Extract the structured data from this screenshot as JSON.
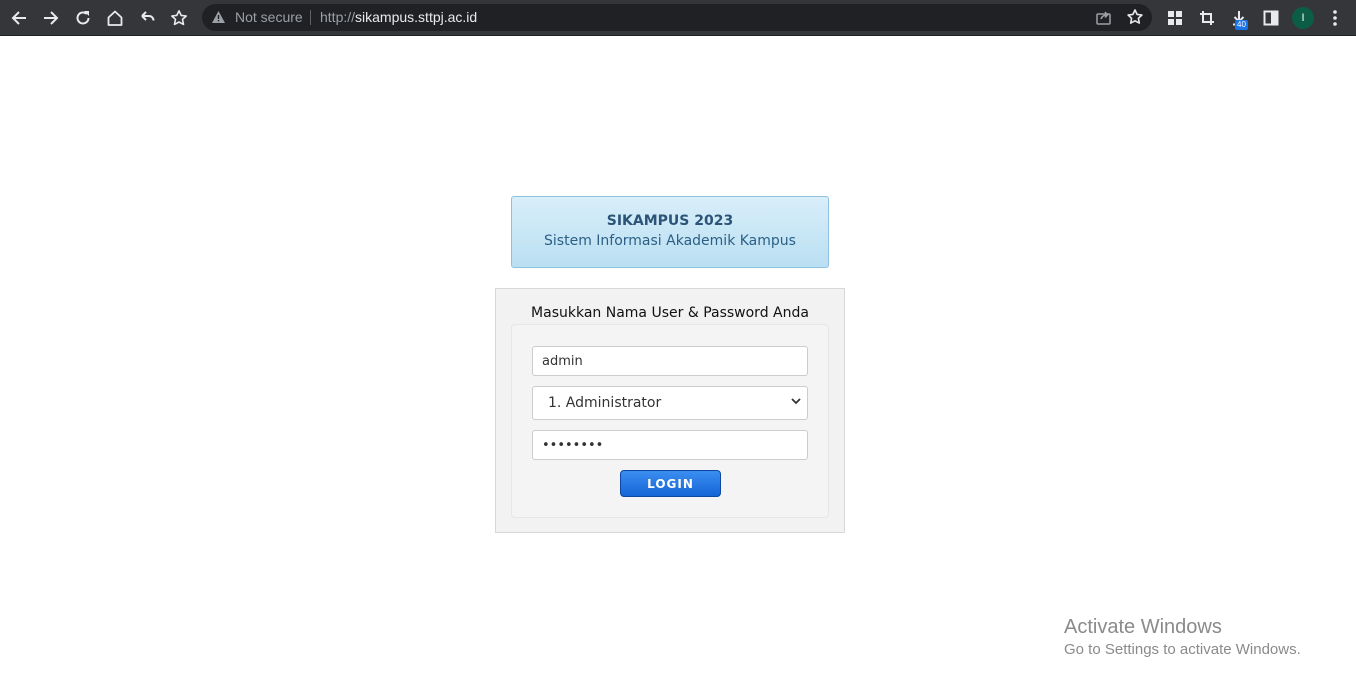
{
  "browser": {
    "security_label": "Not secure",
    "url_scheme": "http://",
    "url_host": "sikampus.sttpj.ac.id",
    "downloads_badge": "40",
    "profile_initial": "I",
    "icons": [
      "back-icon",
      "forward-icon",
      "reload-icon",
      "home-icon",
      "undo-icon",
      "bookmark-star-icon",
      "warning-icon",
      "share-icon",
      "star-icon",
      "extensions-grid-icon",
      "crop-icon",
      "download-icon",
      "side-panel-icon",
      "menu-dots-icon"
    ]
  },
  "header": {
    "title": "SIKAMPUS 2023",
    "subtitle": "Sistem Informasi Akademik Kampus"
  },
  "login": {
    "heading": "Masukkan Nama User & Password Anda",
    "username_value": "admin",
    "role_options": [
      "1. Administrator"
    ],
    "role_selected": "1. Administrator",
    "password_value": "password",
    "button_label": "LOGIN"
  },
  "watermark": {
    "title": "Activate Windows",
    "subtitle": "Go to Settings to activate Windows."
  },
  "colors": {
    "toolbar_bg": "#35363a",
    "omnibox_bg": "#202124",
    "header_border": "#8fc0e0",
    "header_text": "#2b5478",
    "button_blue": "#1565d8",
    "avatar_green": "#0b5e45"
  }
}
